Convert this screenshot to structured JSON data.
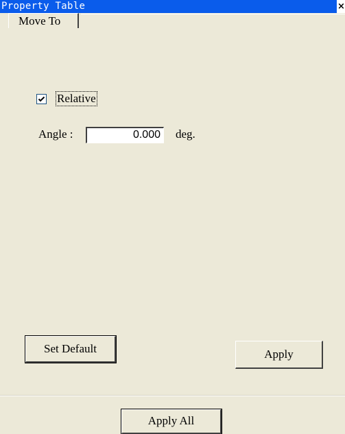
{
  "window": {
    "title": "Property Table",
    "close_glyph": "×"
  },
  "tabs": [
    {
      "label": "Move To",
      "selected": true
    }
  ],
  "relative": {
    "label": "Relative",
    "checked": true
  },
  "angle": {
    "label": "Angle :",
    "value": "0.000",
    "unit": "deg."
  },
  "buttons": {
    "set_default": "Set Default",
    "apply": "Apply",
    "apply_all": "Apply All"
  },
  "colors": {
    "title_bar": "#0a5ceb",
    "face": "#ece9d8"
  }
}
